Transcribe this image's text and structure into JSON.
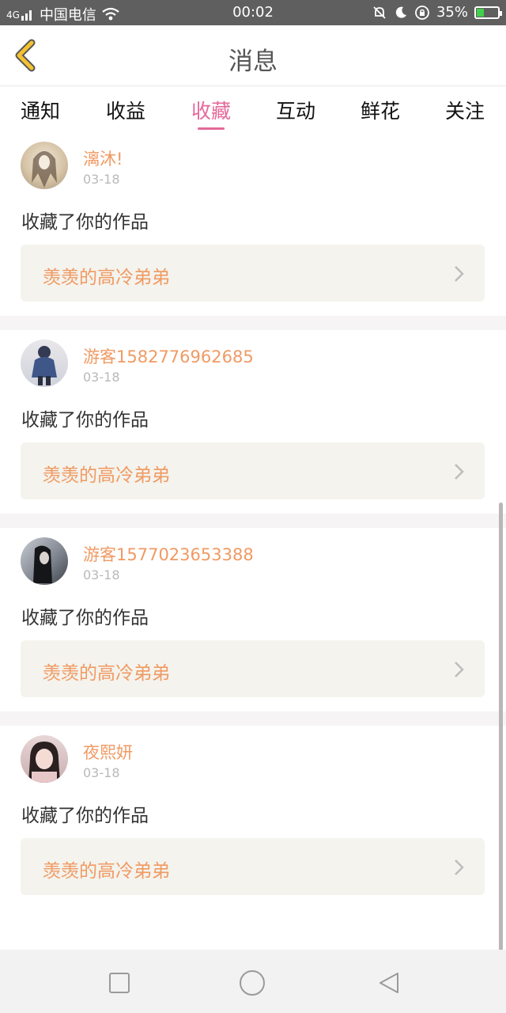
{
  "status_bar": {
    "signal": "4G",
    "carrier": "中国电信",
    "time": "00:02",
    "battery": "35%",
    "battery_level": 0.35
  },
  "header": {
    "title": "消息"
  },
  "tabs": [
    {
      "label": "通知",
      "active": false
    },
    {
      "label": "收益",
      "active": false
    },
    {
      "label": "收藏",
      "active": true
    },
    {
      "label": "互动",
      "active": false
    },
    {
      "label": "鲜花",
      "active": false
    },
    {
      "label": "关注",
      "active": false
    }
  ],
  "feed": [
    {
      "username": "漓沐!",
      "date": "03-18",
      "action": "收藏了你的作品",
      "work_title": "羡羡的高冷弟弟"
    },
    {
      "username": "游客1582776962685",
      "date": "03-18",
      "action": "收藏了你的作品",
      "work_title": "羡羡的高冷弟弟"
    },
    {
      "username": "游客1577023653388",
      "date": "03-18",
      "action": "收藏了你的作品",
      "work_title": "羡羡的高冷弟弟"
    },
    {
      "username": "夜熙妍",
      "date": "03-18",
      "action": "收藏了你的作品",
      "work_title": "羡羡的高冷弟弟"
    }
  ],
  "colors": {
    "accent": "#e46a9a",
    "username": "#f09a63",
    "back_icon": "#f3c233"
  },
  "icons": {
    "back": "back-chevron-icon",
    "wifi": "wifi-icon",
    "mute": "mute-bell-icon",
    "moon": "moon-icon",
    "lock_rotation": "rotation-lock-icon",
    "battery": "battery-icon",
    "nav_recent": "square-icon",
    "nav_home": "circle-icon",
    "nav_back": "triangle-back-icon"
  }
}
